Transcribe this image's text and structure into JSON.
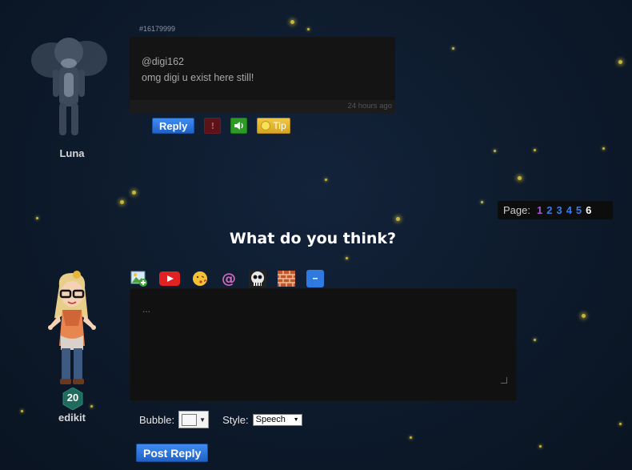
{
  "top_comment": {
    "post_id": "#16179999",
    "mention": "@digi162",
    "message": "omg digi u exist here still!",
    "timestamp": "24 hours ago",
    "author": "Luna",
    "actions": {
      "reply": "Reply",
      "report": "!",
      "tip": "Tip"
    }
  },
  "pagination": {
    "label": "Page:",
    "pages": [
      {
        "num": "1",
        "color": "#a45bd0"
      },
      {
        "num": "2",
        "color": "#3a7ce8"
      },
      {
        "num": "3",
        "color": "#3a7ce8"
      },
      {
        "num": "4",
        "color": "#3a7ce8"
      },
      {
        "num": "5",
        "color": "#3a7ce8"
      },
      {
        "num": "6",
        "color": "#ffffff"
      }
    ]
  },
  "reply_form": {
    "heading": "What do you think?",
    "toolbar": [
      "image-upload",
      "youtube",
      "emoji",
      "mention",
      "skull",
      "brick",
      "more"
    ],
    "placeholder": "...",
    "bubble_label": "Bubble:",
    "style_label": "Style:",
    "style_value": "Speech",
    "post_button": "Post Reply",
    "user": {
      "name": "edikit",
      "level": "20"
    }
  },
  "colors": {
    "accent_blue": "#2f7ae0",
    "tip_gold": "#e6b733",
    "sound_green": "#2c9a25",
    "report_red": "#5a1318"
  }
}
